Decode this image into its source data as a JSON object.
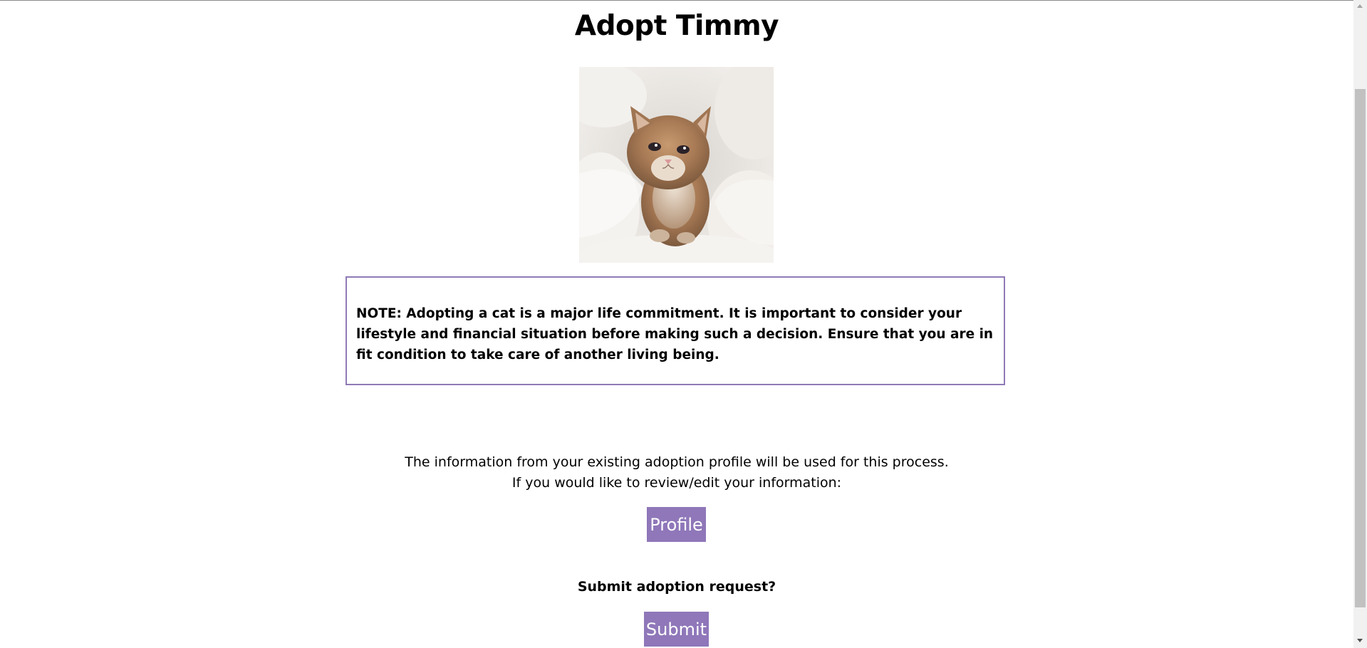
{
  "page": {
    "title": "Adopt Timmy"
  },
  "photo": {
    "subject": "kitten-photo"
  },
  "note": {
    "text": "NOTE: Adopting a cat is a major life commitment. It is important to consider your lifestyle and financial situation before making such a decision. Ensure that you are in fit condition to take care of another living being."
  },
  "info": {
    "line1": "The information from your existing adoption profile will be used for this process.",
    "line2": "If you would like to review/edit your information:"
  },
  "buttons": {
    "profile_label": "Profile",
    "submit_label": "Submit"
  },
  "submit": {
    "question": "Submit adoption request?"
  },
  "colors": {
    "accent": "#8f77b9",
    "note_border": "#8f7ab6"
  }
}
